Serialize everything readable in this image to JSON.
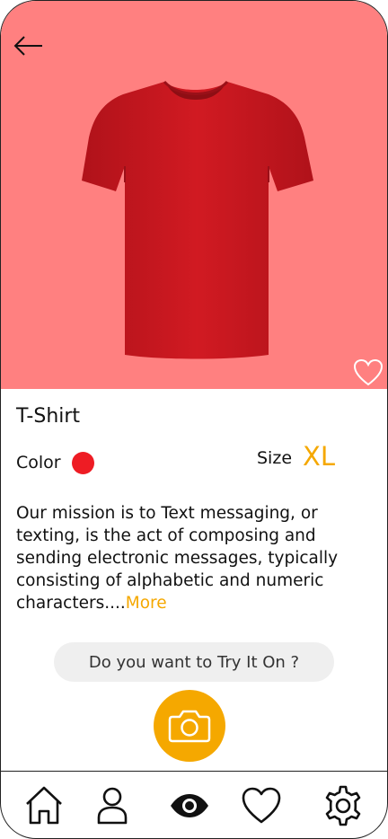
{
  "product": {
    "title": "T-Shirt",
    "color_label": "Color",
    "color_value": "#ee1c24",
    "size_label": "Size",
    "size_value": "XL",
    "description": "Our mission is to Text messaging, or texting, is the act of composing and sending electronic messages, typically consisting of alphabetic and numeric characters....",
    "more_label": "More"
  },
  "try_on": {
    "prompt": "Do you want to Try It On ?"
  },
  "icons": {
    "back": "arrow-left-icon",
    "favorite": "heart-outline-icon",
    "camera": "camera-icon",
    "home": "home-icon",
    "profile": "user-icon",
    "eye": "eye-icon",
    "wishlist": "heart-icon",
    "settings": "gear-icon"
  },
  "colors": {
    "hero_bg": "#ff8080",
    "accent": "#f5a800",
    "shirt": "#c8161e"
  }
}
